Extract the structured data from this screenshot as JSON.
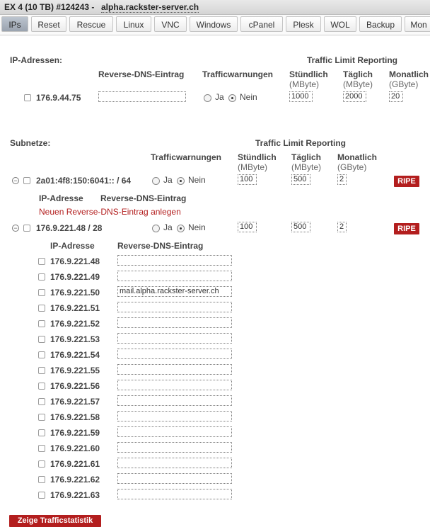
{
  "window": {
    "title": "EX 4 (10 TB) #124243 -",
    "host": "alpha.rackster-server.ch"
  },
  "tabs": [
    "IPs",
    "Reset",
    "Rescue",
    "Linux",
    "VNC",
    "Windows",
    "cPanel",
    "Plesk",
    "WOL",
    "Backup",
    "Mon"
  ],
  "active_tab": "IPs",
  "ip_section": {
    "heading": "IP-Adressen:",
    "traffic_heading": "Traffic Limit Reporting",
    "col_rdns": "Reverse-DNS-Eintrag",
    "col_warn": "Trafficwarnungen",
    "col_hourly": "Stündlich",
    "col_hourly_unit": "(MByte)",
    "col_daily": "Täglich",
    "col_daily_unit": "(MByte)",
    "col_monthly": "Monatlich",
    "col_monthly_unit": "(GByte)",
    "row": {
      "ip": "176.9.44.75",
      "rdns": "",
      "ja": "Ja",
      "nein": "Nein",
      "selected": "Nein",
      "hourly": "1000",
      "daily": "2000",
      "monthly": "20"
    }
  },
  "subnet_section": {
    "heading": "Subnetze:",
    "traffic_heading": "Traffic Limit Reporting",
    "col_warn": "Trafficwarnungen",
    "col_hourly": "Stündlich",
    "col_hourly_unit": "(MByte)",
    "col_daily": "Täglich",
    "col_daily_unit": "(MByte)",
    "col_monthly": "Monatlich",
    "col_monthly_unit": "(GByte)",
    "ripe_label": "RIPE",
    "subnet1": {
      "net": "2a01:4f8:150:6041:: / 64",
      "ja": "Ja",
      "nein": "Nein",
      "selected": "Nein",
      "hourly": "100",
      "daily": "500",
      "monthly": "2",
      "col_ip": "IP-Adresse",
      "col_rdns": "Reverse-DNS-Eintrag",
      "new_entry_link": "Neuen Reverse-DNS-Eintrag anlegen"
    },
    "subnet2": {
      "net": "176.9.221.48 / 28",
      "ja": "Ja",
      "nein": "Nein",
      "selected": "Nein",
      "hourly": "100",
      "daily": "500",
      "monthly": "2",
      "col_ip": "IP-Adresse",
      "col_rdns": "Reverse-DNS-Eintrag",
      "rows": [
        {
          "ip": "176.9.221.48",
          "rdns": ""
        },
        {
          "ip": "176.9.221.49",
          "rdns": ""
        },
        {
          "ip": "176.9.221.50",
          "rdns": "mail.alpha.rackster-server.ch"
        },
        {
          "ip": "176.9.221.51",
          "rdns": ""
        },
        {
          "ip": "176.9.221.52",
          "rdns": ""
        },
        {
          "ip": "176.9.221.53",
          "rdns": ""
        },
        {
          "ip": "176.9.221.54",
          "rdns": ""
        },
        {
          "ip": "176.9.221.55",
          "rdns": ""
        },
        {
          "ip": "176.9.221.56",
          "rdns": ""
        },
        {
          "ip": "176.9.221.57",
          "rdns": ""
        },
        {
          "ip": "176.9.221.58",
          "rdns": ""
        },
        {
          "ip": "176.9.221.59",
          "rdns": ""
        },
        {
          "ip": "176.9.221.60",
          "rdns": ""
        },
        {
          "ip": "176.9.221.61",
          "rdns": ""
        },
        {
          "ip": "176.9.221.62",
          "rdns": ""
        },
        {
          "ip": "176.9.221.63",
          "rdns": ""
        }
      ]
    }
  },
  "footer": {
    "traffic_stats_button": "Zeige Trafficstatistik"
  },
  "colors": {
    "accent_red": "#b31e1e",
    "active_tab": "#aab2bd"
  }
}
